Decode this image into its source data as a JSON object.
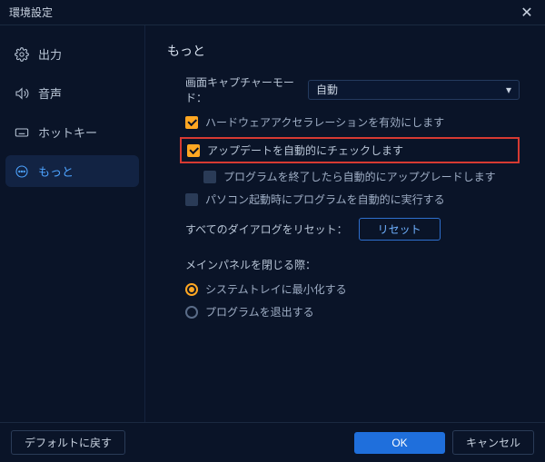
{
  "window": {
    "title": "環境設定"
  },
  "sidebar": {
    "items": [
      {
        "label": "出力"
      },
      {
        "label": "音声"
      },
      {
        "label": "ホットキー"
      },
      {
        "label": "もっと"
      }
    ]
  },
  "main": {
    "heading": "もっと",
    "captureMode": {
      "label": "画面キャプチャーモード：",
      "value": "自動"
    },
    "checks": {
      "hwAccel": "ハードウェアアクセラレーションを有効にします",
      "autoUpdate": "アップデートを自動的にチェックします",
      "autoUpgrade": "プログラムを終了したら自動的にアップグレードします",
      "runOnBoot": "パソコン起動時にプログラムを自動的に実行する"
    },
    "resetRow": {
      "label": "すべてのダイアログをリセット：",
      "button": "リセット"
    },
    "closeBehavior": {
      "label": "メインパネルを閉じる際：",
      "tray": "システムトレイに最小化する",
      "exit": "プログラムを退出する"
    }
  },
  "footer": {
    "restoreDefaults": "デフォルトに戻す",
    "ok": "OK",
    "cancel": "キャンセル"
  }
}
